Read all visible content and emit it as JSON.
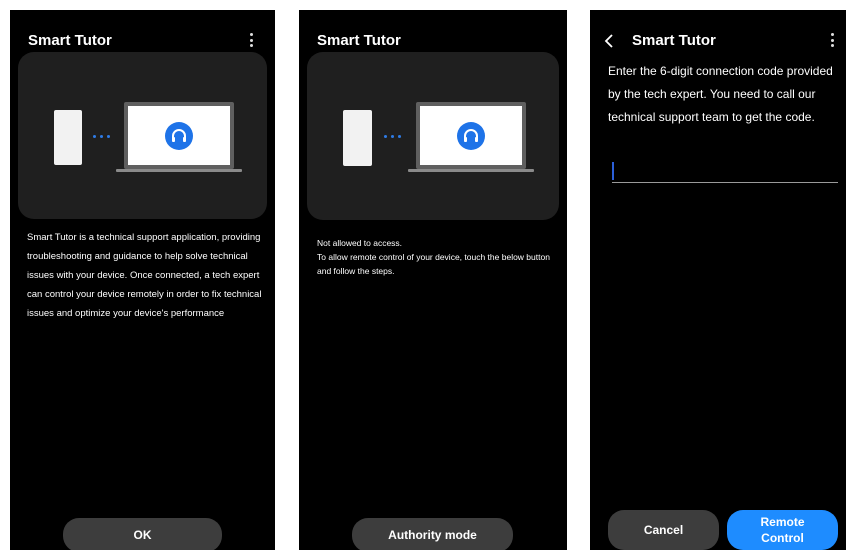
{
  "screen1": {
    "title": "Smart Tutor",
    "description": "Smart Tutor is a technical support application, providing troubleshooting and guidance to help solve technical issues with your device. Once connected, a tech expert can control your device remotely in order to fix technical issues and optimize your device's performance",
    "ok_label": "OK"
  },
  "screen2": {
    "title": "Smart Tutor",
    "line1": "Not allowed to access.",
    "line2": "To allow remote control of your device, touch the below button and follow the steps.",
    "authority_label": "Authority mode"
  },
  "screen3": {
    "title": "Smart Tutor",
    "instruction": "Enter the 6-digit connection code provided by the tech expert. You need to call our technical support team to get the code.",
    "code_value": "",
    "cancel_label": "Cancel",
    "remote_label": "Remote Control"
  },
  "colors": {
    "accent": "#1e73e8",
    "button_blue": "#1e8cff",
    "button_gray": "#3d3d3d",
    "background": "#000000"
  },
  "icons": [
    "more-vert-icon",
    "back-arrow-icon",
    "headset-icon"
  ]
}
